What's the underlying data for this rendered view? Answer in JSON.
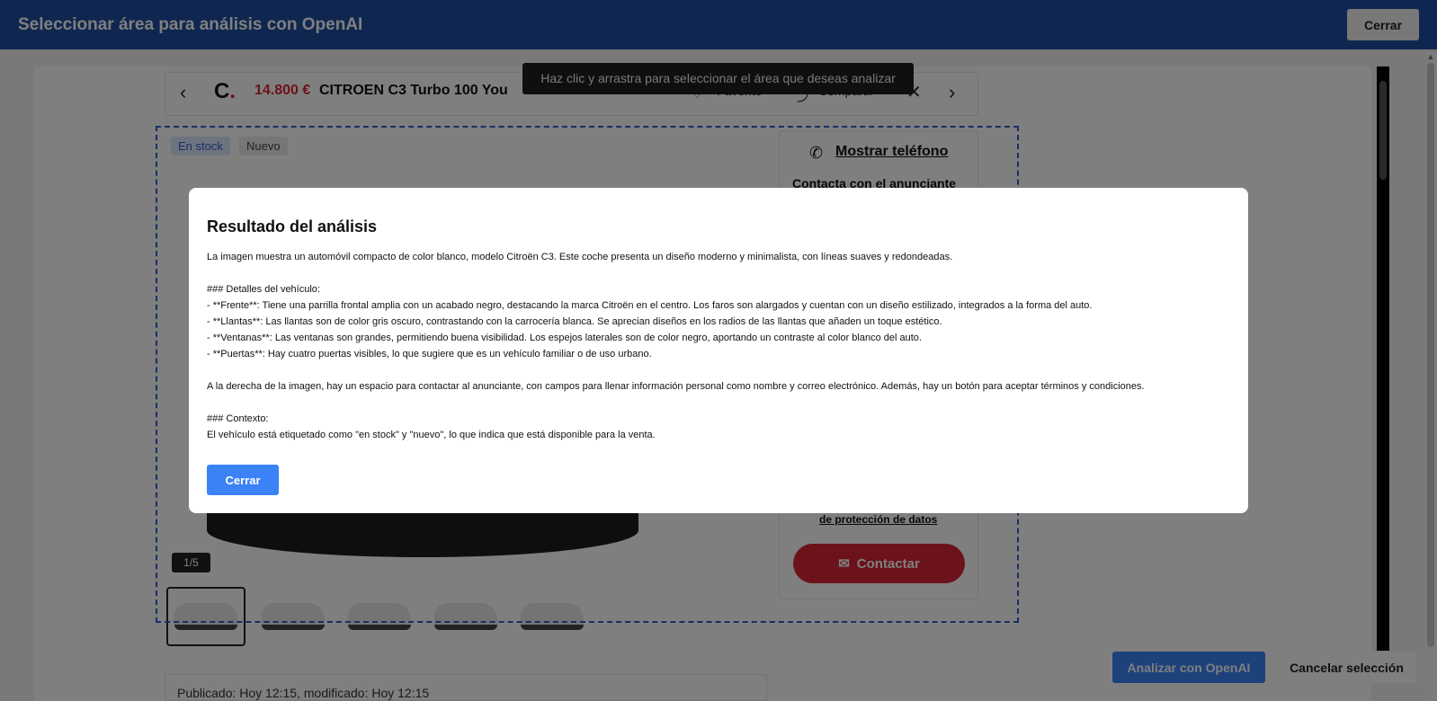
{
  "top_bar": {
    "title": "Seleccionar área para análisis con OpenAI",
    "close_label": "Cerrar",
    "color": "#1e4fa0"
  },
  "tooltip": "Haz clic y arrastra para seleccionar el área que deseas analizar",
  "listing": {
    "logo_text": "C",
    "logo_dot": ".",
    "price": "14.800 €",
    "title": "CITROEN C3 Turbo 100 You",
    "favorite_label": "Favorito",
    "share_label": "Compartir",
    "badges": [
      "En stock",
      "Nuevo"
    ],
    "photo_counter": "1/5",
    "thumbnails_count": 5,
    "published": "Publicado: Hoy 12:15, modificado: Hoy 12:15"
  },
  "contact": {
    "show_phone": "Mostrar teléfono",
    "heading": "Contacta con el anunciante",
    "privacy_link": "de protección de datos",
    "contact_button": "Contactar",
    "accent": "#d92534"
  },
  "actions": {
    "analyze": "Analizar con OpenAI",
    "cancel_selection": "Cancelar selección"
  },
  "modal": {
    "title": "Resultado del análisis",
    "body": "La imagen muestra un automóvil compacto de color blanco, modelo Citroën C3. Este coche presenta un diseño moderno y minimalista, con líneas suaves y redondeadas.\n\n### Detalles del vehículo:\n- **Frente**: Tiene una parrilla frontal amplia con un acabado negro, destacando la marca Citroën en el centro. Los faros son alargados y cuentan con un diseño estilizado, integrados a la forma del auto.\n- **Llantas**: Las llantas son de color gris oscuro, contrastando con la carrocería blanca. Se aprecian diseños en los radios de las llantas que añaden un toque estético.\n- **Ventanas**: Las ventanas son grandes, permitiendo buena visibilidad. Los espejos laterales son de color negro, aportando un contraste al color blanco del auto.\n- **Puertas**: Hay cuatro puertas visibles, lo que sugiere que es un vehículo familiar o de uso urbano.\n\nA la derecha de la imagen, hay un espacio para contactar al anunciante, con campos para llenar información personal como nombre y correo electrónico. Además, hay un botón para aceptar términos y condiciones.\n\n### Contexto:\nEl vehículo está etiquetado como \"en stock\" y \"nuevo\", lo que indica que está disponible para la venta.",
    "close_label": "Cerrar",
    "button_color": "#3b82f6"
  },
  "icons": {
    "back": "chevron-left-icon",
    "next": "chevron-right-icon",
    "favorite": "heart-icon",
    "share": "share-icon",
    "close": "close-icon",
    "phone": "phone-icon",
    "mail": "mail-icon"
  }
}
